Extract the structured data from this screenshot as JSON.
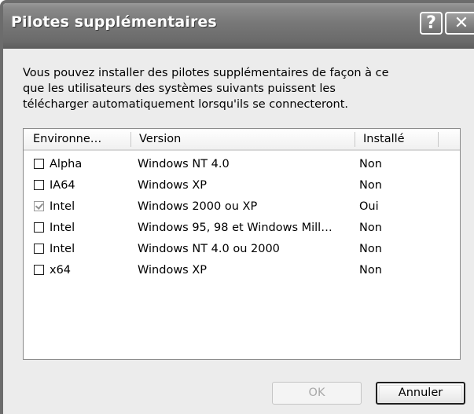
{
  "window": {
    "title": "Pilotes supplémentaires",
    "help_label": "?",
    "close_label": "✕"
  },
  "description": {
    "line1": "Vous pouvez installer des pilotes supplémentaires de façon à ce",
    "line2": "que les utilisateurs des systèmes suivants puissent les",
    "line3": "télécharger automatiquement lorsqu'ils se connecteront."
  },
  "list": {
    "columns": [
      "Environne…",
      "Version",
      "Installé"
    ],
    "rows": [
      {
        "checked": false,
        "environment": "Alpha",
        "version": "Windows NT 4.0",
        "installed": "Non"
      },
      {
        "checked": false,
        "environment": "IA64",
        "version": "Windows XP",
        "installed": "Non"
      },
      {
        "checked": true,
        "environment": "Intel",
        "version": "Windows 2000 ou XP",
        "installed": "Oui"
      },
      {
        "checked": false,
        "environment": "Intel",
        "version": "Windows 95, 98 et Windows Mill…",
        "installed": "Non"
      },
      {
        "checked": false,
        "environment": "Intel",
        "version": "Windows NT 4.0 ou 2000",
        "installed": "Non"
      },
      {
        "checked": false,
        "environment": "x64",
        "version": "Windows XP",
        "installed": "Non"
      }
    ]
  },
  "buttons": {
    "ok_label": "OK",
    "cancel_label": "Annuler"
  }
}
